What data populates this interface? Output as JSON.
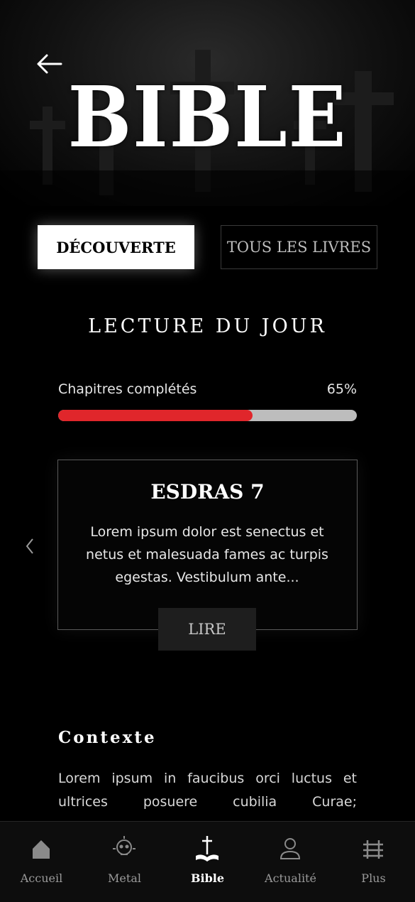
{
  "header": {
    "title": "BIBLE",
    "back_icon": "arrow-left-icon"
  },
  "tabs": [
    {
      "label": "DÉCOUVERTE",
      "active": true
    },
    {
      "label": "TOUS LES LIVRES",
      "active": false
    }
  ],
  "daily_reading": {
    "title": "LECTURE DU JOUR",
    "progress_label": "Chapitres complétés",
    "progress_text": "65%",
    "progress_fraction": 0.65,
    "card": {
      "title": "ESDRAS 7",
      "text": "Lorem ipsum dolor est senectus et netus et malesuada fames ac turpis egestas. Vestibulum ante...",
      "button_label": "LIRE"
    }
  },
  "context": {
    "title": "Contexte",
    "text": "Lorem ipsum in faucibus orci luctus et ultrices posuere cubilia Curae;"
  },
  "nav": [
    {
      "label": "Accueil",
      "icon": "home-icon",
      "active": false
    },
    {
      "label": "Metal",
      "icon": "skull-icon",
      "active": false
    },
    {
      "label": "Bible",
      "icon": "bible-cross-icon",
      "active": true
    },
    {
      "label": "Actualité",
      "icon": "user-icon",
      "active": false
    },
    {
      "label": "Plus",
      "icon": "menu-icon",
      "active": false
    }
  ],
  "colors": {
    "accent": "#e0262b",
    "track": "#bdbdbd",
    "background": "#000000"
  }
}
